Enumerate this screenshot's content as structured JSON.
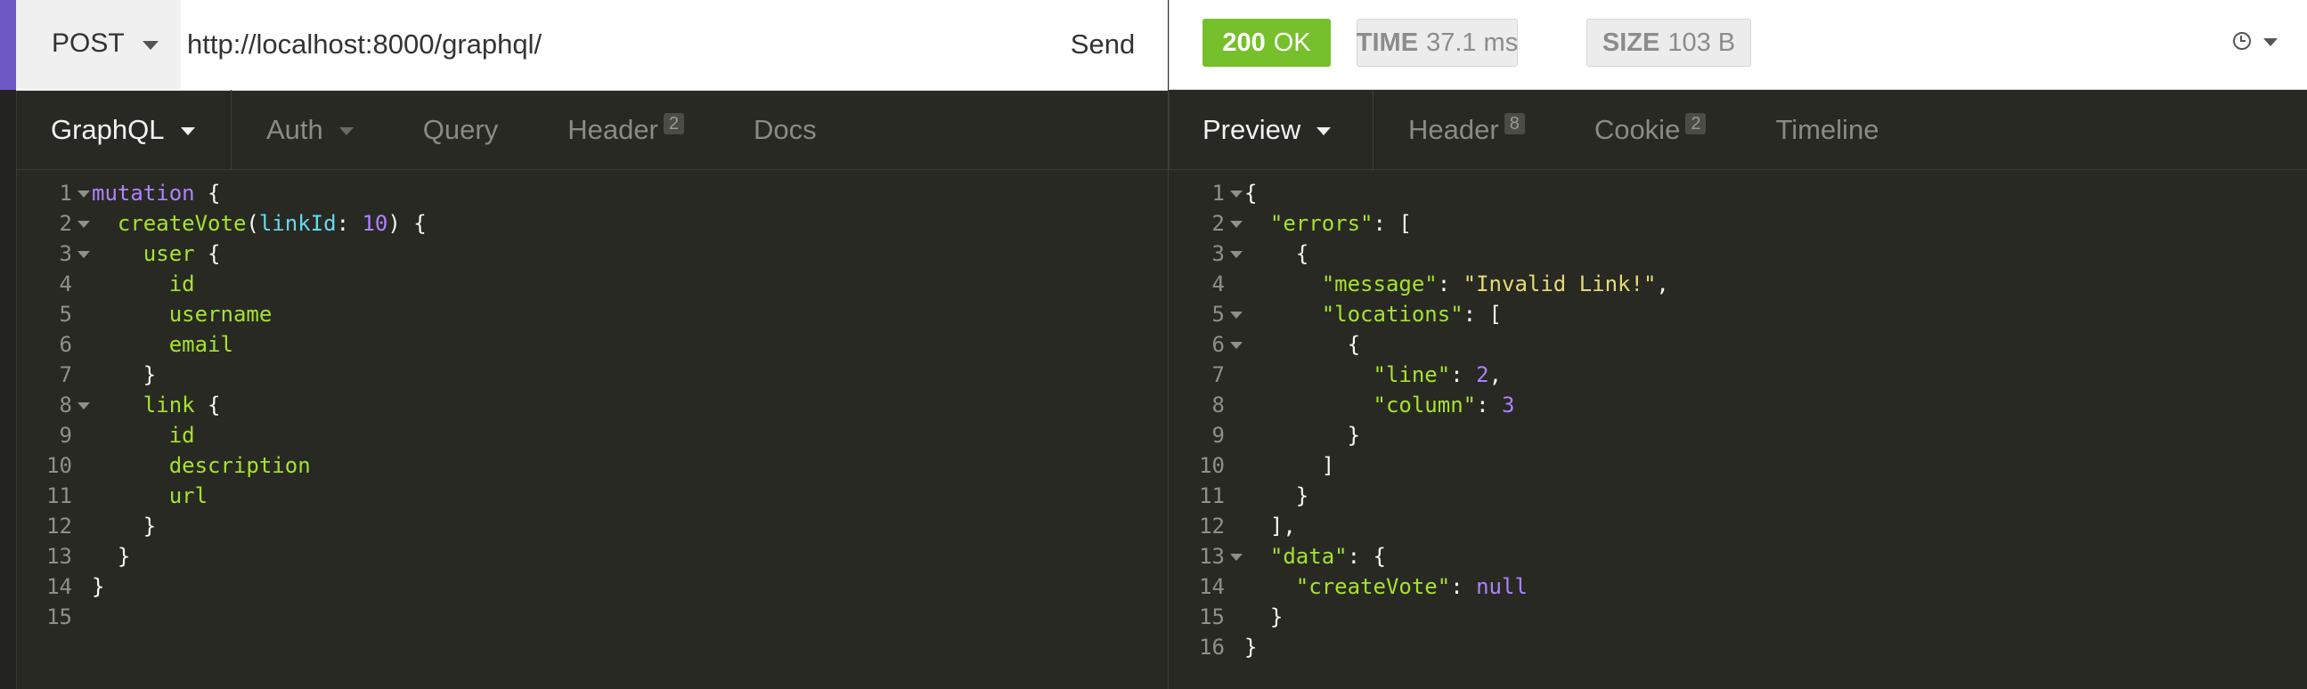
{
  "request": {
    "method": "POST",
    "url": "http://localhost:8000/graphql/",
    "send_label": "Send",
    "tabs": [
      {
        "label": "GraphQL",
        "caret": true
      },
      {
        "label": "Auth",
        "caret": true
      },
      {
        "label": "Query"
      },
      {
        "label": "Header",
        "count": "2"
      },
      {
        "label": "Docs"
      }
    ]
  },
  "response": {
    "status_code": "200",
    "status_text": "OK",
    "time_label": "TIME",
    "time_value": "37.1 ms",
    "size_label": "SIZE",
    "size_value": "103 B",
    "tabs": [
      {
        "label": "Preview",
        "caret": true
      },
      {
        "label": "Header",
        "count": "8"
      },
      {
        "label": "Cookie",
        "count": "2"
      },
      {
        "label": "Timeline"
      }
    ]
  },
  "query_editor": {
    "lines": [
      {
        "n": "1",
        "fold": true,
        "tokens": [
          [
            "kw",
            "mutation"
          ],
          [
            "punc",
            " {"
          ]
        ]
      },
      {
        "n": "2",
        "fold": true,
        "tokens": [
          [
            "punc",
            "  "
          ],
          [
            "fn",
            "createVote"
          ],
          [
            "punc",
            "("
          ],
          [
            "arg",
            "linkId"
          ],
          [
            "punc",
            ": "
          ],
          [
            "num",
            "10"
          ],
          [
            "punc",
            ") {"
          ]
        ]
      },
      {
        "n": "3",
        "fold": true,
        "tokens": [
          [
            "punc",
            "    "
          ],
          [
            "field",
            "user"
          ],
          [
            "punc",
            " {"
          ]
        ]
      },
      {
        "n": "4",
        "tokens": [
          [
            "punc",
            "      "
          ],
          [
            "field",
            "id"
          ]
        ]
      },
      {
        "n": "5",
        "tokens": [
          [
            "punc",
            "      "
          ],
          [
            "field",
            "username"
          ]
        ]
      },
      {
        "n": "6",
        "tokens": [
          [
            "punc",
            "      "
          ],
          [
            "field",
            "email"
          ]
        ]
      },
      {
        "n": "7",
        "tokens": [
          [
            "punc",
            "    }"
          ]
        ]
      },
      {
        "n": "8",
        "fold": true,
        "tokens": [
          [
            "punc",
            "    "
          ],
          [
            "field",
            "link"
          ],
          [
            "punc",
            " {"
          ]
        ]
      },
      {
        "n": "9",
        "tokens": [
          [
            "punc",
            "      "
          ],
          [
            "field",
            "id"
          ]
        ]
      },
      {
        "n": "10",
        "tokens": [
          [
            "punc",
            "      "
          ],
          [
            "field",
            "description"
          ]
        ]
      },
      {
        "n": "11",
        "tokens": [
          [
            "punc",
            "      "
          ],
          [
            "field",
            "url"
          ]
        ]
      },
      {
        "n": "12",
        "tokens": [
          [
            "punc",
            "    }"
          ]
        ]
      },
      {
        "n": "13",
        "tokens": [
          [
            "punc",
            "  }"
          ]
        ]
      },
      {
        "n": "14",
        "tokens": [
          [
            "punc",
            "}"
          ]
        ]
      },
      {
        "n": "15",
        "tokens": []
      }
    ]
  },
  "response_viewer": {
    "lines": [
      {
        "n": "1",
        "fold": true,
        "tokens": [
          [
            "punc",
            "{"
          ]
        ]
      },
      {
        "n": "2",
        "fold": true,
        "tokens": [
          [
            "punc",
            "  "
          ],
          [
            "key",
            "\"errors\""
          ],
          [
            "punc",
            ": ["
          ]
        ]
      },
      {
        "n": "3",
        "fold": true,
        "tokens": [
          [
            "punc",
            "    {"
          ]
        ]
      },
      {
        "n": "4",
        "tokens": [
          [
            "punc",
            "      "
          ],
          [
            "key",
            "\"message\""
          ],
          [
            "punc",
            ": "
          ],
          [
            "str",
            "\"Invalid Link!\""
          ],
          [
            "punc",
            ","
          ]
        ]
      },
      {
        "n": "5",
        "fold": true,
        "tokens": [
          [
            "punc",
            "      "
          ],
          [
            "key",
            "\"locations\""
          ],
          [
            "punc",
            ": ["
          ]
        ]
      },
      {
        "n": "6",
        "fold": true,
        "tokens": [
          [
            "punc",
            "        {"
          ]
        ]
      },
      {
        "n": "7",
        "tokens": [
          [
            "punc",
            "          "
          ],
          [
            "key",
            "\"line\""
          ],
          [
            "punc",
            ": "
          ],
          [
            "num",
            "2"
          ],
          [
            "punc",
            ","
          ]
        ]
      },
      {
        "n": "8",
        "tokens": [
          [
            "punc",
            "          "
          ],
          [
            "key",
            "\"column\""
          ],
          [
            "punc",
            ": "
          ],
          [
            "num",
            "3"
          ]
        ]
      },
      {
        "n": "9",
        "tokens": [
          [
            "punc",
            "        }"
          ]
        ]
      },
      {
        "n": "10",
        "tokens": [
          [
            "punc",
            "      ]"
          ]
        ]
      },
      {
        "n": "11",
        "tokens": [
          [
            "punc",
            "    }"
          ]
        ]
      },
      {
        "n": "12",
        "tokens": [
          [
            "punc",
            "  ],"
          ]
        ]
      },
      {
        "n": "13",
        "fold": true,
        "tokens": [
          [
            "punc",
            "  "
          ],
          [
            "key",
            "\"data\""
          ],
          [
            "punc",
            ": {"
          ]
        ]
      },
      {
        "n": "14",
        "tokens": [
          [
            "punc",
            "    "
          ],
          [
            "key",
            "\"createVote\""
          ],
          [
            "punc",
            ": "
          ],
          [
            "null",
            "null"
          ]
        ]
      },
      {
        "n": "15",
        "tokens": [
          [
            "punc",
            "  }"
          ]
        ]
      },
      {
        "n": "16",
        "tokens": [
          [
            "punc",
            "}"
          ]
        ]
      }
    ]
  },
  "colors": {
    "accent": "#6d59c6",
    "status_ok": "#76c12b",
    "editor_bg": "#282923"
  },
  "icons": {
    "method_dropdown": "chevron-down-icon",
    "history": "clock-icon",
    "fold": "fold-caret-icon"
  }
}
